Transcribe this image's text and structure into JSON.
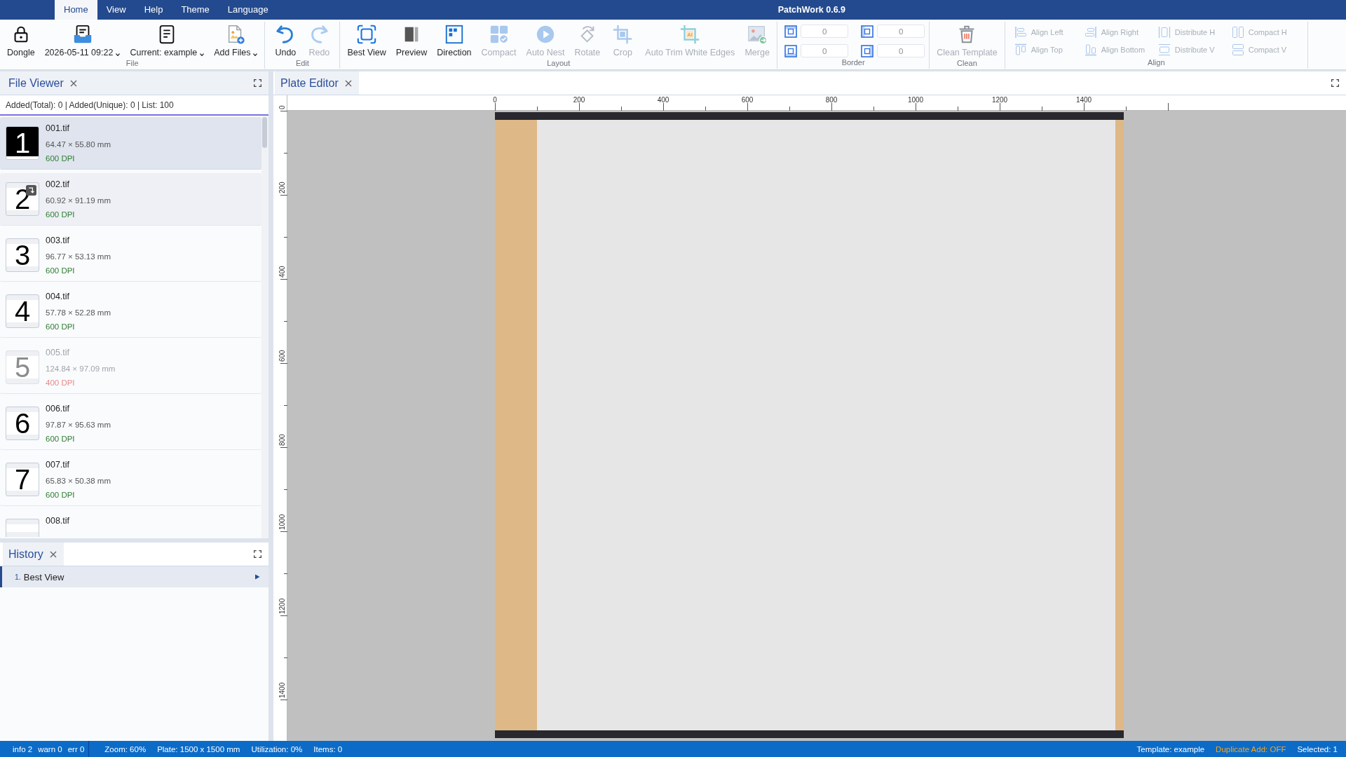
{
  "menu": {
    "tabs": [
      {
        "label": "Home",
        "selected": true
      },
      {
        "label": "View",
        "selected": false
      },
      {
        "label": "Help",
        "selected": false
      },
      {
        "label": "Theme",
        "selected": false
      },
      {
        "label": "Language",
        "selected": false
      }
    ],
    "title": "PatchWork 0.6.9"
  },
  "ribbon": {
    "groups": [
      {
        "kind": "buttons",
        "label": "File",
        "buttons": [
          {
            "kind": "lock",
            "label": "Dongle",
            "dropdown": false,
            "disabled": false
          },
          {
            "kind": "tray",
            "label": "2026-05-11 09:22",
            "dropdown": true,
            "disabled": false
          },
          {
            "kind": "document",
            "label": "Current: example",
            "dropdown": true,
            "disabled": false
          },
          {
            "kind": "add-file",
            "label": "Add Files",
            "dropdown": true,
            "disabled": false
          }
        ]
      },
      {
        "kind": "buttons",
        "label": "Edit",
        "buttons": [
          {
            "kind": "undo",
            "label": "Undo",
            "dropdown": false,
            "disabled": false
          },
          {
            "kind": "redo",
            "label": "Redo",
            "dropdown": false,
            "disabled": true
          }
        ]
      },
      {
        "kind": "buttons",
        "label": "Layout",
        "buttons": [
          {
            "kind": "best-view",
            "label": "Best View",
            "dropdown": false,
            "disabled": false
          },
          {
            "kind": "preview",
            "label": "Preview",
            "dropdown": false,
            "disabled": false
          },
          {
            "kind": "direction",
            "label": "Direction",
            "dropdown": false,
            "disabled": false
          },
          {
            "kind": "compact",
            "label": "Compact",
            "dropdown": false,
            "disabled": true
          },
          {
            "kind": "auto-nest",
            "label": "Auto Nest",
            "dropdown": false,
            "disabled": true
          },
          {
            "kind": "rotate",
            "label": "Rotate",
            "dropdown": false,
            "disabled": true
          },
          {
            "kind": "crop",
            "label": "Crop",
            "dropdown": false,
            "disabled": true
          },
          {
            "kind": "auto-trim",
            "label": "Auto Trim White Edges",
            "icon_text": "AI",
            "dropdown": false,
            "disabled": true
          },
          {
            "kind": "merge",
            "label": "Merge",
            "dropdown": false,
            "disabled": true
          }
        ]
      },
      {
        "kind": "fields",
        "label": "Border",
        "fields": [
          {
            "kind": "top",
            "value": "0"
          },
          {
            "kind": "left",
            "value": "0"
          },
          {
            "kind": "bottom",
            "value": "0"
          },
          {
            "kind": "right",
            "value": "0"
          }
        ]
      },
      {
        "kind": "buttons",
        "label": "Clean",
        "buttons": [
          {
            "kind": "trash",
            "label": "Clean Template",
            "dropdown": false,
            "disabled": true
          }
        ]
      },
      {
        "kind": "small-buttons",
        "label": "Align",
        "buttons": [
          {
            "kind": "align-left",
            "label": "Align Left",
            "disabled": true
          },
          {
            "kind": "align-right",
            "label": "Align Right",
            "disabled": true
          },
          {
            "kind": "distribute-h",
            "label": "Distribute H",
            "disabled": true
          },
          {
            "kind": "compact-h",
            "label": "Compact H",
            "disabled": true
          },
          {
            "kind": "align-top",
            "label": "Align Top",
            "disabled": true
          },
          {
            "kind": "align-bottom",
            "label": "Align Bottom",
            "disabled": true
          },
          {
            "kind": "distribute-v",
            "label": "Distribute V",
            "disabled": true
          },
          {
            "kind": "compact-v",
            "label": "Compact V",
            "disabled": true
          }
        ]
      }
    ]
  },
  "file_viewer": {
    "title": "File Viewer",
    "focused": true,
    "stats": "Added(Total): 0 | Added(Unique): 0 | List: 100",
    "files": [
      {
        "kind": "dark",
        "thumb": "1",
        "name": "001.tif",
        "size": "64.47 × 55.80 mm",
        "dpi": "600 DPI",
        "selected": true,
        "hovered": false,
        "rotated": false,
        "low_dpi": false
      },
      {
        "kind": "light",
        "thumb": "2",
        "name": "002.tif",
        "size": "60.92 × 91.19 mm",
        "dpi": "600 DPI",
        "selected": false,
        "hovered": true,
        "rotated": true,
        "low_dpi": false
      },
      {
        "kind": "light",
        "thumb": "3",
        "name": "003.tif",
        "size": "96.77 × 53.13 mm",
        "dpi": "600 DPI",
        "selected": false,
        "hovered": false,
        "rotated": false,
        "low_dpi": false
      },
      {
        "kind": "light",
        "thumb": "4",
        "name": "004.tif",
        "size": "57.78 × 52.28 mm",
        "dpi": "600 DPI",
        "selected": false,
        "hovered": false,
        "rotated": false,
        "low_dpi": false
      },
      {
        "kind": "light",
        "thumb": "5",
        "name": "005.tif",
        "size": "124.84 × 97.09 mm",
        "dpi": "400 DPI",
        "selected": false,
        "hovered": false,
        "rotated": false,
        "low_dpi": true
      },
      {
        "kind": "light",
        "thumb": "6",
        "name": "006.tif",
        "size": "97.87 × 95.63 mm",
        "dpi": "600 DPI",
        "selected": false,
        "hovered": false,
        "rotated": false,
        "low_dpi": false
      },
      {
        "kind": "light",
        "thumb": "7",
        "name": "007.tif",
        "size": "65.83 × 50.38 mm",
        "dpi": "600 DPI",
        "selected": false,
        "hovered": false,
        "rotated": false,
        "low_dpi": false
      },
      {
        "kind": "light",
        "name": "008.tif",
        "selected": false,
        "hovered": false,
        "rotated": false,
        "low_dpi": false
      }
    ]
  },
  "history": {
    "title": "History",
    "focused": false,
    "items": [
      {
        "number": "1.",
        "label": "Best View",
        "selected": true
      }
    ]
  },
  "plate_editor": {
    "title": "Plate Editor",
    "focused": false,
    "ruler": {
      "top_labels": [
        "0",
        "200",
        "400",
        "600",
        "800",
        "1000",
        "1200",
        "1400"
      ],
      "left_labels": [
        "0",
        "200",
        "400",
        "600",
        "800",
        "1000",
        "1200",
        "1400"
      ]
    }
  },
  "status_bar": {
    "log": [
      "info 2",
      "warn 0",
      "err 0"
    ],
    "middle": [
      "Zoom: 60%",
      "Plate: 1500 x 1500 mm",
      "Utilization: 0%",
      "Items: 0"
    ],
    "right": [
      {
        "text": "Template: example",
        "highlighted": false
      },
      {
        "text": "Duplicate Add: OFF",
        "highlighted": true
      },
      {
        "text": "Selected: 1",
        "highlighted": false
      }
    ]
  }
}
